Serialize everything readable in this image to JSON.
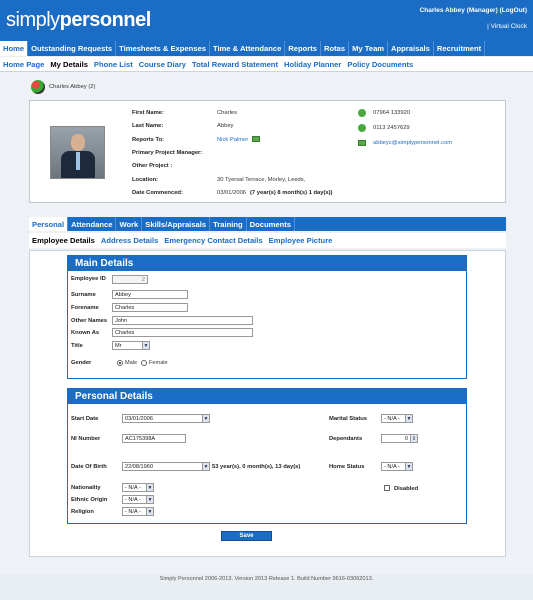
{
  "brand": {
    "part1": "simply",
    "part2": "personnel"
  },
  "user": {
    "label": "Charles Abbey (Manager)",
    "logout": "(LogOut)",
    "virtual_clock": "| Virtual Clock"
  },
  "nav_main": [
    {
      "label": "Home",
      "active": true
    },
    {
      "label": "Outstanding Requests"
    },
    {
      "label": "Timesheets & Expenses"
    },
    {
      "label": "Time & Attendance"
    },
    {
      "label": "Reports"
    },
    {
      "label": "Rotas"
    },
    {
      "label": "My Team"
    },
    {
      "label": "Appraisals"
    },
    {
      "label": "Recruitment"
    }
  ],
  "nav_sub": [
    {
      "label": "Home Page"
    },
    {
      "label": "My Details",
      "active": true
    },
    {
      "label": "Phone List"
    },
    {
      "label": "Course Diary"
    },
    {
      "label": "Total Reward Statement"
    },
    {
      "label": "Holiday Planner"
    },
    {
      "label": "Policy Documents"
    }
  ],
  "employee_header": "Charles Abbey (2)",
  "summary": {
    "first_name_label": "First Name:",
    "first_name": "Charles",
    "last_name_label": "Last Name:",
    "last_name": "Abbey",
    "reports_to_label": "Reports To:",
    "reports_to": "Nick Palmer",
    "primary_manager_label": "Primary Project Manager:",
    "other_project_label": "Other Project :",
    "location_label": "Location:",
    "location": "30 Tyersal Terrace, Morley, Leeds,",
    "commenced_label": "Date Commenced:",
    "commenced_date": "03/01/2006",
    "commenced_duration": "(7 year(s) 8 month(s) 1 day(s))",
    "phone1": "07964 133920",
    "phone2": "0113 2457629",
    "email": "abbeyc@simplypersonnel.com"
  },
  "tabs_main": [
    {
      "label": "Personal",
      "active": true
    },
    {
      "label": "Attendance"
    },
    {
      "label": "Work"
    },
    {
      "label": "Skills/Appraisals"
    },
    {
      "label": "Training"
    },
    {
      "label": "Documents"
    }
  ],
  "tabs_sub": [
    {
      "label": "Employee Details",
      "active": true
    },
    {
      "label": "Address Details"
    },
    {
      "label": "Emergency Contact Details"
    },
    {
      "label": "Employee Picture"
    }
  ],
  "main_details": {
    "title": "Main Details",
    "employee_id_label": "Employee ID",
    "employee_id": "2",
    "surname_label": "Surname",
    "surname": "Abbey",
    "forename_label": "Forename",
    "forename": "Charles",
    "other_names_label": "Other Names",
    "other_names": "John",
    "known_as_label": "Known As",
    "known_as": "Charles",
    "title_label": "Title",
    "title_value": "Mr",
    "gender_label": "Gender",
    "gender_male": "Male",
    "gender_female": "Female",
    "gender_selected": "Male"
  },
  "personal_details": {
    "title": "Personal Details",
    "start_date_label": "Start Date",
    "start_date": "03/01/2006",
    "ni_label": "NI Number",
    "ni_number": "AC175398A",
    "dob_label": "Date Of Birth",
    "dob": "22/08/1960",
    "age_text": "53 year(s), 0 month(s), 13 day(s)",
    "nationality_label": "Nationality",
    "nationality": "- N/A -",
    "ethnic_label": "Ethnic Origin",
    "ethnic": "- N/A -",
    "religion_label": "Religion",
    "religion": "- N/A -",
    "marital_label": "Marital Status",
    "marital": "- N/A -",
    "dependants_label": "Dependants",
    "dependants": "0",
    "home_status_label": "Home Status",
    "home_status": "- N/A -",
    "disabled_label": "Disabled"
  },
  "save_label": "Save",
  "footer": "Simply Personnel 2006-2013.  Version 2013 Release 1. Build Number 9616-03062013."
}
